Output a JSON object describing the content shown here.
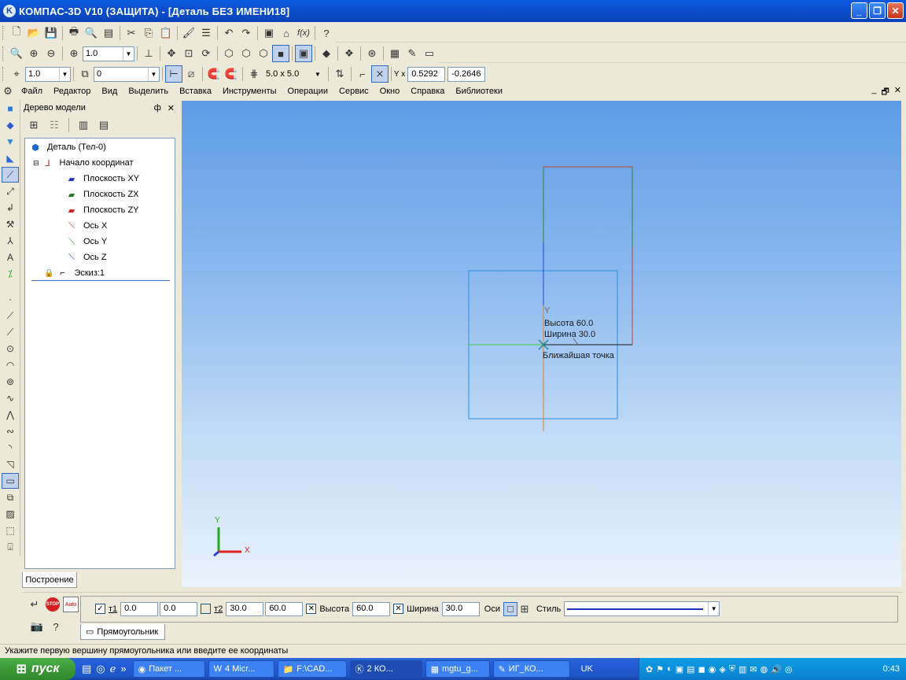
{
  "window": {
    "title": "КОМПАС-3D V10 (ЗАЩИТА) - [Деталь БЕЗ ИМЕНИ18]",
    "app_icon": "K",
    "buttons": {
      "minimize": "_",
      "maximize": "❐",
      "close": "✕"
    }
  },
  "toolbar2": {
    "zoom_value": "1.0"
  },
  "toolbar3": {
    "step_value": "1.0",
    "layer_value": "0",
    "grid_label": "5.0 x 5.0",
    "coord_x": "0.5292",
    "coord_y": "-0.2646",
    "coord_label": "Y x"
  },
  "menu": {
    "items": [
      "Файл",
      "Редактор",
      "Вид",
      "Выделить",
      "Вставка",
      "Инструменты",
      "Операции",
      "Сервис",
      "Окно",
      "Справка",
      "Библиотеки"
    ],
    "mdi_buttons": [
      "_",
      "🗗",
      "✕"
    ]
  },
  "tree": {
    "header": "Дерево модели",
    "header_buttons": [
      "ф",
      "✕"
    ],
    "items": [
      {
        "label": "Деталь (Тел-0)",
        "icon": "part-icon"
      },
      {
        "label": "Начало координат",
        "icon": "origin-icon"
      },
      {
        "label": "Плоскость XY",
        "icon": "plane-xy-icon"
      },
      {
        "label": "Плоскость ZX",
        "icon": "plane-zx-icon"
      },
      {
        "label": "Плоскость ZY",
        "icon": "plane-zy-icon"
      },
      {
        "label": "Ось X",
        "icon": "axis-x-icon"
      },
      {
        "label": "Ось Y",
        "icon": "axis-y-icon"
      },
      {
        "label": "Ось Z",
        "icon": "axis-z-icon"
      },
      {
        "label": "Эскиз:1",
        "icon": "sketch-icon"
      }
    ],
    "bottom_tab": "Построение"
  },
  "viewport": {
    "hint_axis_label": "Y",
    "hint_height": "Высота 60.0",
    "hint_width": "Ширина 30.0",
    "hint_snap": "Ближайшая точка",
    "axis_y_label": "Y",
    "axis_x_label": "X",
    "colors": {
      "blue_rect": "#2a8fe0",
      "red_rect": "#c8412a",
      "axis_green": "#22aa22",
      "axis_red": "#dd2222",
      "axis_blue": "#2244dd"
    }
  },
  "properties": {
    "t1_label": "т1",
    "t1_x": "0.0",
    "t1_y": "0.0",
    "t2_label": "т2",
    "t2_x": "30.0",
    "t2_y": "60.0",
    "height_label": "Высота",
    "height_value": "60.0",
    "width_label": "Ширина",
    "width_value": "30.0",
    "axes_label": "Оси",
    "style_label": "Стиль",
    "tab": "Прямоугольник",
    "auto_label": "Auto",
    "stop_label": "STOP"
  },
  "status": {
    "text": "Укажите первую вершину прямоугольника или введите ее координаты"
  },
  "taskbar": {
    "start": "пуск",
    "tasks": [
      "Пакет ...",
      "4 Micr...",
      "F:\\CAD...",
      "2 КО...",
      "mgtu_g...",
      "ИГ_КО..."
    ],
    "lang": "UK",
    "clock": "0:43"
  }
}
